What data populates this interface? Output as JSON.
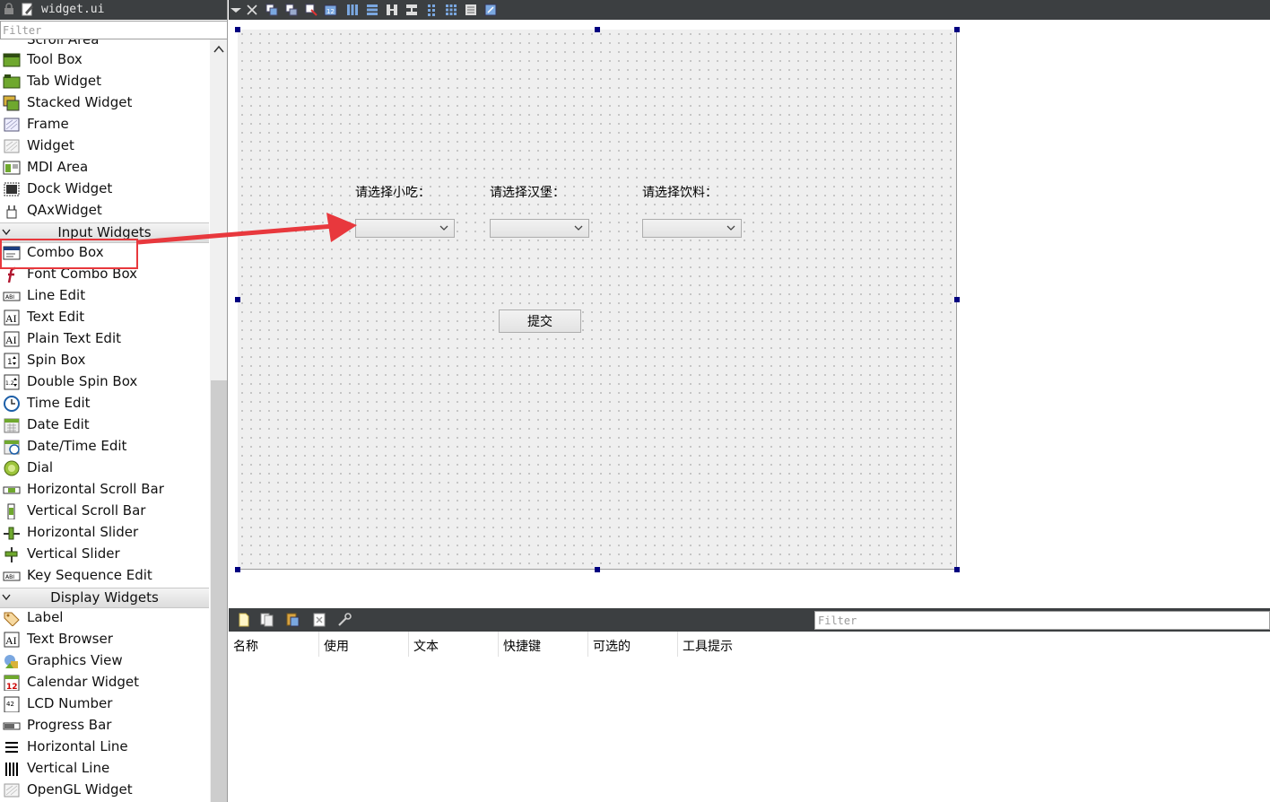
{
  "file_tab": {
    "filename": "widget.ui"
  },
  "widget_box": {
    "filter_placeholder": "Filter",
    "cut_item": "Scroll Area",
    "container_items": [
      {
        "label": "Tool Box",
        "icon": "tool-box-icon"
      },
      {
        "label": "Tab Widget",
        "icon": "tab-widget-icon"
      },
      {
        "label": "Stacked Widget",
        "icon": "stacked-widget-icon"
      },
      {
        "label": "Frame",
        "icon": "frame-icon"
      },
      {
        "label": "Widget",
        "icon": "widget-icon"
      },
      {
        "label": "MDI Area",
        "icon": "mdi-area-icon"
      },
      {
        "label": "Dock Widget",
        "icon": "dock-widget-icon"
      },
      {
        "label": "QAxWidget",
        "icon": "qaxwidget-icon"
      }
    ],
    "input_category": "Input Widgets",
    "input_items": [
      {
        "label": "Combo Box",
        "icon": "combo-box-icon"
      },
      {
        "label": "Font Combo Box",
        "icon": "font-combo-box-icon"
      },
      {
        "label": "Line Edit",
        "icon": "line-edit-icon"
      },
      {
        "label": "Text Edit",
        "icon": "text-edit-icon"
      },
      {
        "label": "Plain Text Edit",
        "icon": "plain-text-edit-icon"
      },
      {
        "label": "Spin Box",
        "icon": "spin-box-icon"
      },
      {
        "label": "Double Spin Box",
        "icon": "double-spin-box-icon"
      },
      {
        "label": "Time Edit",
        "icon": "time-edit-icon"
      },
      {
        "label": "Date Edit",
        "icon": "date-edit-icon"
      },
      {
        "label": "Date/Time Edit",
        "icon": "date-time-edit-icon"
      },
      {
        "label": "Dial",
        "icon": "dial-icon"
      },
      {
        "label": "Horizontal Scroll Bar",
        "icon": "horizontal-scroll-bar-icon"
      },
      {
        "label": "Vertical Scroll Bar",
        "icon": "vertical-scroll-bar-icon"
      },
      {
        "label": "Horizontal Slider",
        "icon": "horizontal-slider-icon"
      },
      {
        "label": "Vertical Slider",
        "icon": "vertical-slider-icon"
      },
      {
        "label": "Key Sequence Edit",
        "icon": "key-sequence-edit-icon"
      }
    ],
    "display_category": "Display Widgets",
    "display_items": [
      {
        "label": "Label",
        "icon": "label-icon"
      },
      {
        "label": "Text Browser",
        "icon": "text-browser-icon"
      },
      {
        "label": "Graphics View",
        "icon": "graphics-view-icon"
      },
      {
        "label": "Calendar Widget",
        "icon": "calendar-widget-icon"
      },
      {
        "label": "LCD Number",
        "icon": "lcd-number-icon"
      },
      {
        "label": "Progress Bar",
        "icon": "progress-bar-icon"
      },
      {
        "label": "Horizontal Line",
        "icon": "horizontal-line-icon"
      },
      {
        "label": "Vertical Line",
        "icon": "vertical-line-icon"
      },
      {
        "label": "OpenGL Widget",
        "icon": "opengl-widget-icon"
      }
    ]
  },
  "form": {
    "label_snack": "请选择小吃：",
    "label_burger": "请选择汉堡：",
    "label_drink": "请选择饮料：",
    "submit_label": "提交"
  },
  "action_editor": {
    "filter_placeholder": "Filter",
    "columns": [
      "名称",
      "使用",
      "文本",
      "快捷键",
      "可选的",
      "工具提示"
    ]
  },
  "colors": {
    "dark_bar": "#3c3f41",
    "selection_handle": "#000080",
    "annotation_red": "#e8383d"
  }
}
